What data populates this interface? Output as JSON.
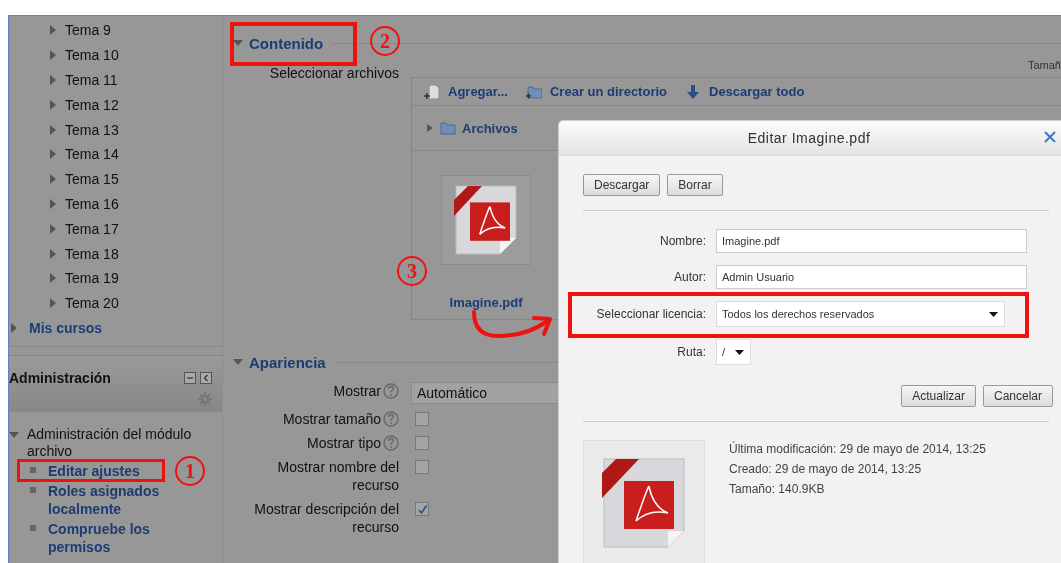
{
  "sidebar": {
    "topics": [
      {
        "label": "Tema 9",
        "expanded": false
      },
      {
        "label": "Tema 10",
        "expanded": false
      },
      {
        "label": "Tema 11",
        "expanded": false
      },
      {
        "label": "Tema 12",
        "expanded": false
      },
      {
        "label": "Tema 13",
        "expanded": false
      },
      {
        "label": "Tema 14",
        "expanded": false
      },
      {
        "label": "Tema 15",
        "expanded": false
      },
      {
        "label": "Tema 16",
        "expanded": false
      },
      {
        "label": "Tema 17",
        "expanded": false
      },
      {
        "label": "Tema 18",
        "expanded": false
      },
      {
        "label": "Tema 19",
        "expanded": false
      },
      {
        "label": "Tema 20",
        "expanded": false
      }
    ],
    "my_courses": {
      "label": "Mis cursos",
      "expanded": false
    },
    "admin_block": {
      "title": "Administración",
      "node": {
        "label": "Administración del módulo archivo",
        "expanded": true,
        "children": [
          {
            "label": "Editar ajustes"
          },
          {
            "label": "Roles asignados localmente"
          },
          {
            "label": "Compruebe los permisos"
          }
        ]
      }
    }
  },
  "content_section": {
    "title": "Contenido",
    "expanded": true,
    "field_label": "Seleccionar archivos",
    "size_header": "Tamañ",
    "toolbar": [
      {
        "kind": "add",
        "label": "Agregar..."
      },
      {
        "kind": "folder",
        "label": "Crear un directorio"
      },
      {
        "kind": "download",
        "label": "Descargar todo"
      }
    ],
    "path": "Archivos",
    "files": [
      {
        "name": "Imagine.pdf"
      }
    ]
  },
  "appearance_section": {
    "title": "Apariencia",
    "expanded": true,
    "rows": [
      {
        "kind": "select",
        "label": "Mostrar",
        "help": true,
        "value": "Automático"
      },
      {
        "kind": "checkbox",
        "label": "Mostrar tamaño",
        "help": true,
        "checked": false
      },
      {
        "kind": "checkbox",
        "label": "Mostrar tipo",
        "help": true,
        "checked": false
      },
      {
        "kind": "checkbox",
        "label": "Mostrar nombre del recurso",
        "help": false,
        "checked": false
      },
      {
        "kind": "checkbox",
        "label": "Mostrar descripción del recurso",
        "help": false,
        "checked": true
      }
    ]
  },
  "dialog": {
    "title": "Editar Imagine.pdf",
    "top_buttons": [
      "Descargar",
      "Borrar"
    ],
    "fields": [
      {
        "kind": "text",
        "label": "Nombre:",
        "value": "Imagine.pdf"
      },
      {
        "kind": "text",
        "label": "Autor:",
        "value": "Admin Usuario"
      },
      {
        "kind": "select",
        "label": "Seleccionar licencia:",
        "value": "Todos los derechos reservados"
      },
      {
        "kind": "narrow_select",
        "label": "Ruta:",
        "value": "/"
      }
    ],
    "bottom_buttons": [
      "Actualizar",
      "Cancelar"
    ],
    "info": [
      "Última modificación: 29 de mayo de 2014, 13:25",
      "Creado: 29 de mayo de 2014, 13:25",
      "Tamaño: 140.9KB"
    ]
  },
  "annotations": [
    {
      "label": "1"
    },
    {
      "label": "2"
    },
    {
      "label": "3"
    }
  ]
}
